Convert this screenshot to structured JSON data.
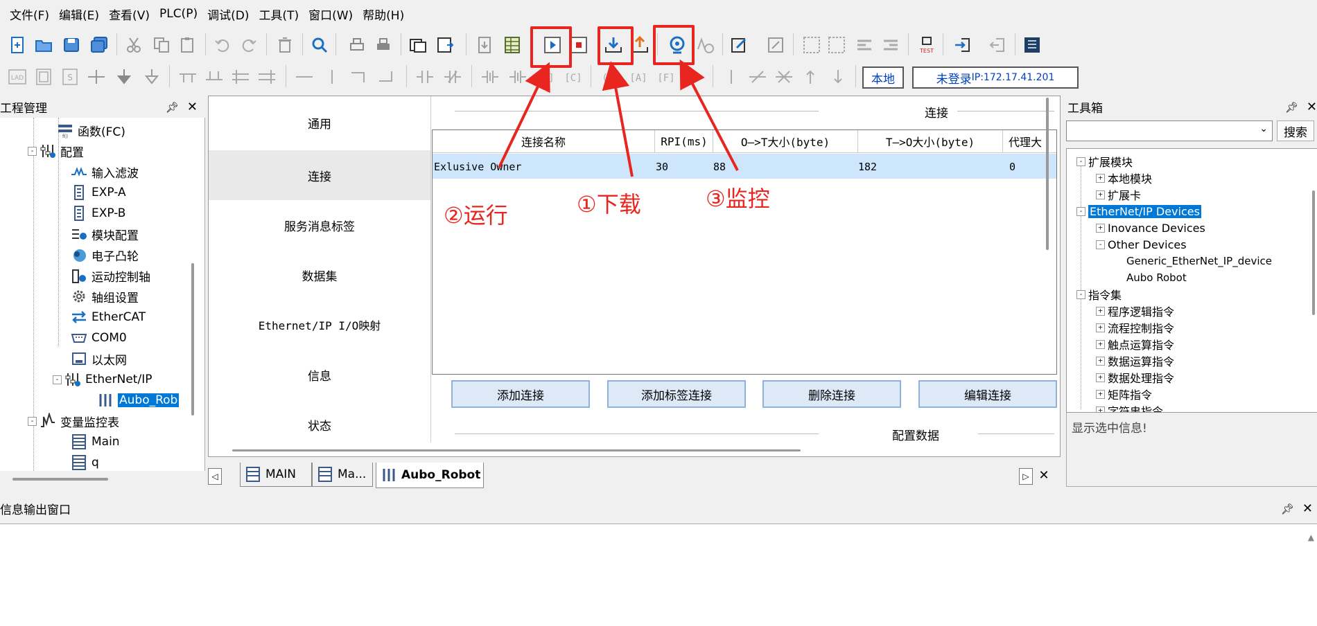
{
  "menu": [
    "文件(F)",
    "编辑(E)",
    "查看(V)",
    "PLC(P)",
    "调试(D)",
    "工具(T)",
    "窗口(W)",
    "帮助(H)"
  ],
  "toolbar2": {
    "local_label": "本地",
    "login_label": "未登录",
    "ip_label": "IP:172.17.41.201"
  },
  "project_panel": {
    "title": "工程管理",
    "items": [
      {
        "label": "函数(FC)",
        "icon": "function-icon"
      },
      {
        "label": "配置",
        "icon": "config-icon"
      },
      {
        "label": "输入滤波",
        "icon": "filter-icon"
      },
      {
        "label": "EXP-A",
        "icon": "module-icon"
      },
      {
        "label": "EXP-B",
        "icon": "module-icon"
      },
      {
        "label": "模块配置",
        "icon": "module-config-icon"
      },
      {
        "label": "电子凸轮",
        "icon": "cam-icon"
      },
      {
        "label": "运动控制轴",
        "icon": "axis-icon"
      },
      {
        "label": "轴组设置",
        "icon": "gear-icon"
      },
      {
        "label": "EtherCAT",
        "icon": "ethercat-icon"
      },
      {
        "label": "COM0",
        "icon": "com-port-icon"
      },
      {
        "label": "以太网",
        "icon": "ethernet-icon"
      },
      {
        "label": "EtherNet/IP",
        "icon": "ethernet-ip-icon"
      },
      {
        "label": "Aubo_Rob",
        "icon": "device-icon"
      },
      {
        "label": "变量监控表",
        "icon": "monitor-table-icon"
      },
      {
        "label": "Main",
        "icon": "table-icon"
      },
      {
        "label": "q",
        "icon": "table-icon"
      }
    ]
  },
  "editor": {
    "nav": [
      "通用",
      "连接",
      "服务消息标签",
      "数据集",
      "Ethernet/IP I/O映射",
      "信息",
      "状态"
    ],
    "section_title": "连接",
    "columns": [
      "连接名称",
      "RPI(ms)",
      "O—>T大小(byte)",
      "T—>O大小(byte)",
      "代理大"
    ],
    "row": [
      "Exlusive Owner",
      "30",
      "88",
      "182",
      "0"
    ],
    "buttons": [
      "添加连接",
      "添加标签连接",
      "删除连接",
      "编辑连接"
    ],
    "config_title": "配置数据"
  },
  "tabs": [
    "MAIN",
    "Ma...",
    "Aubo_Robot"
  ],
  "toolbox": {
    "title": "工具箱",
    "search_button": "搜索",
    "items": [
      {
        "label": "扩展模块",
        "level": 0,
        "sign": "-"
      },
      {
        "label": "本地模块",
        "level": 1,
        "sign": "+"
      },
      {
        "label": "扩展卡",
        "level": 1,
        "sign": "+"
      },
      {
        "label": "EtherNet/IP Devices",
        "level": 0,
        "sign": "-"
      },
      {
        "label": "Inovance Devices",
        "level": 1,
        "sign": "+"
      },
      {
        "label": "Other Devices",
        "level": 1,
        "sign": "-"
      },
      {
        "label": "Generic_EtherNet_IP_device",
        "level": 2,
        "sign": ""
      },
      {
        "label": "Aubo Robot",
        "level": 2,
        "sign": ""
      },
      {
        "label": "指令集",
        "level": 0,
        "sign": "-"
      },
      {
        "label": "程序逻辑指令",
        "level": 1,
        "sign": "+"
      },
      {
        "label": "流程控制指令",
        "level": 1,
        "sign": "+"
      },
      {
        "label": "触点运算指令",
        "level": 1,
        "sign": "+"
      },
      {
        "label": "数据运算指令",
        "level": 1,
        "sign": "+"
      },
      {
        "label": "数据处理指令",
        "level": 1,
        "sign": "+"
      },
      {
        "label": "矩阵指令",
        "level": 1,
        "sign": "+"
      },
      {
        "label": "字符串指令",
        "level": 1,
        "sign": "+"
      }
    ],
    "info_text": "显示选中信息!"
  },
  "output_panel": {
    "title": "信息输出窗口"
  },
  "annotations": {
    "run": "②运行",
    "download": "①下载",
    "monitor": "③监控"
  },
  "colors": {
    "accent": "#0078d7",
    "highlight": "#e8251e",
    "selected_row": "#cde6fb"
  }
}
